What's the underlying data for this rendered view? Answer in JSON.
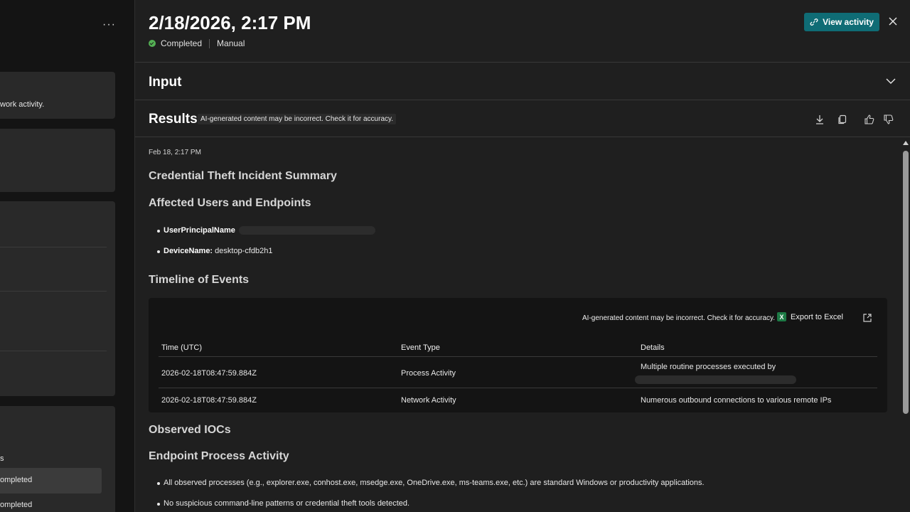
{
  "left": {
    "more_label": "···",
    "card1_text": "work activity.",
    "list_header": "s",
    "list_items": [
      "ompleted",
      "ompleted"
    ]
  },
  "header": {
    "title": "2/18/2026, 2:17 PM",
    "status": "Completed",
    "mode": "Manual",
    "view_activity_label": "View activity"
  },
  "input": {
    "title": "Input"
  },
  "results": {
    "title": "Results",
    "ai_disclaimer": "AI-generated content may be incorrect. Check it for accuracy.",
    "timestamp": "Feb 18, 2:17 PM",
    "summary_heading": "Credential Theft Incident Summary",
    "affected_heading": "Affected Users and Endpoints",
    "affected": [
      {
        "key": "UserPrincipalName",
        "value": ""
      },
      {
        "key": "DeviceName:",
        "value": " desktop-cfdb2h1"
      }
    ],
    "timeline_heading": "Timeline of Events",
    "table": {
      "disclaimer": "AI-generated content may be incorrect. Check it for accuracy.",
      "export_label": "Export to Excel",
      "columns": [
        "Time (UTC)",
        "Event Type",
        "Details"
      ],
      "rows": [
        {
          "time": "2026-02-18T08:47:59.884Z",
          "type": "Process Activity",
          "details": "Multiple routine processes executed by"
        },
        {
          "time": "2026-02-18T08:47:59.884Z",
          "type": "Network Activity",
          "details": "Numerous outbound connections to various remote IPs"
        }
      ]
    },
    "iocs_heading": "Observed IOCs",
    "endpoint_heading": "Endpoint Process Activity",
    "endpoint_bullets": [
      "All observed processes (e.g., explorer.exe, conhost.exe, msedge.exe, OneDrive.exe, ms-teams.exe, etc.) are standard Windows or productivity applications.",
      "No suspicious command-line patterns or credential theft tools detected."
    ]
  },
  "colors": {
    "accent": "#0f6c75",
    "status_success": "#54b054",
    "panel_bg": "#1f1f1f",
    "table_bg": "#141414"
  }
}
